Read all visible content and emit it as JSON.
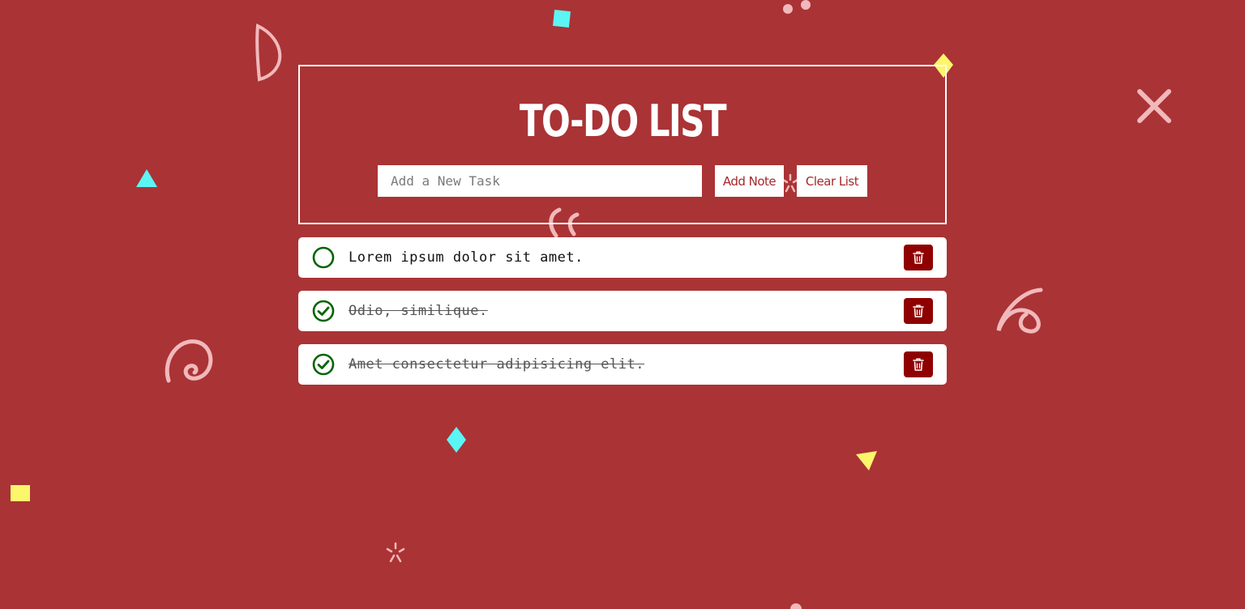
{
  "app": {
    "title": "TO-DO LIST"
  },
  "form": {
    "input_placeholder": "Add a New Task",
    "input_value": "",
    "add_label": "Add Note",
    "clear_label": "Clear List"
  },
  "tasks": [
    {
      "text": "Lorem ipsum dolor sit amet.",
      "completed": false
    },
    {
      "text": "Odio, similique.",
      "completed": true
    },
    {
      "text": "Amet consectetur adipisicing elit.",
      "completed": true
    }
  ],
  "icons": {
    "check": "check-circle-icon",
    "uncheck": "circle-icon",
    "delete": "trash-icon"
  },
  "colors": {
    "background": "#aa3335",
    "accent": "#a5282a",
    "delete_button": "#8f0000",
    "check": "#006400",
    "confetti_cyan": "#5cf5f5",
    "confetti_yellow": "#fcf66c",
    "confetti_pink": "#f1b9bb"
  }
}
